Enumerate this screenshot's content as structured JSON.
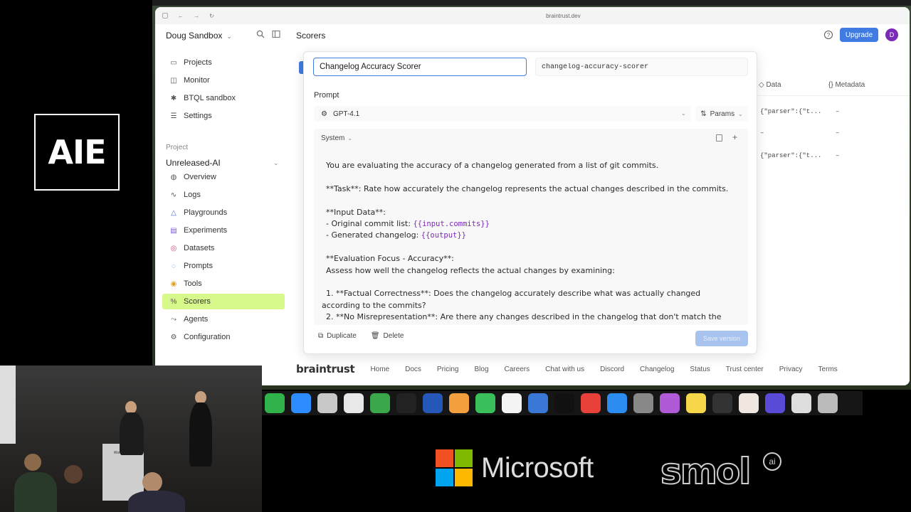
{
  "event_logo": "AIE",
  "browser": {
    "url": "braintrust.dev"
  },
  "header": {
    "workspace": "Doug Sandbox",
    "page_title": "Scorers",
    "upgrade_label": "Upgrade",
    "avatar_initial": "D"
  },
  "sidebar": {
    "top_items": [
      {
        "label": "Projects",
        "icon": "folder-icon"
      },
      {
        "label": "Monitor",
        "icon": "chart-icon"
      },
      {
        "label": "BTQL sandbox",
        "icon": "asterisk-icon"
      },
      {
        "label": "Settings",
        "icon": "sliders-icon"
      }
    ],
    "section_label": "Project",
    "project_name": "Unreleased-AI",
    "project_items": [
      {
        "label": "Overview",
        "icon": "globe-icon"
      },
      {
        "label": "Logs",
        "icon": "activity-icon"
      },
      {
        "label": "Playgrounds",
        "icon": "shapes-icon"
      },
      {
        "label": "Experiments",
        "icon": "beaker-icon"
      },
      {
        "label": "Datasets",
        "icon": "database-icon"
      },
      {
        "label": "Prompts",
        "icon": "message-icon"
      },
      {
        "label": "Tools",
        "icon": "bolt-icon"
      },
      {
        "label": "Scorers",
        "icon": "percent-icon",
        "active": true
      },
      {
        "label": "Agents",
        "icon": "route-icon"
      },
      {
        "label": "Configuration",
        "icon": "gear-icon"
      }
    ]
  },
  "table_bg": {
    "columns": [
      "Data",
      "Metadata"
    ],
    "rows": [
      {
        "data": "{\"parser\":{\"t...",
        "metadata": "–"
      },
      {
        "data": "–",
        "metadata": "–"
      },
      {
        "data": "{\"parser\":{\"t...",
        "metadata": "–"
      }
    ]
  },
  "modal": {
    "name_value": "Changelog Accuracy Scorer",
    "slug_value": "changelog-accuracy-scorer",
    "prompt_label": "Prompt",
    "model": "GPT-4.1",
    "params_label": "Params",
    "role": "System",
    "prompt_lines": {
      "l1": "You are evaluating the accuracy of a changelog generated from a list of git commits.",
      "l2": "**Task**: Rate how accurately the changelog represents the actual changes described in the commits.",
      "l3": "**Input Data**:",
      "l4a": "- Original commit list: ",
      "l4b": "{{input.commits}}",
      "l5a": "- Generated changelog: ",
      "l5b": "{{output}}",
      "l6": "**Evaluation Focus - Accuracy**:",
      "l7": "Assess how well the changelog reflects the actual changes by examining:",
      "l8": "1. **Factual Correctness**: Does the changelog accurately describe what was actually changed",
      "l9": "according to the commits?",
      "l10": "2. **No Misrepresentation**: Are there any changes described in the changelog that don't match the"
    },
    "duplicate_label": "Duplicate",
    "delete_label": "Delete",
    "save_label": "Save version"
  },
  "footer": {
    "brand": "braintrust",
    "links": [
      "Home",
      "Docs",
      "Pricing",
      "Blog",
      "Careers",
      "Chat with us",
      "Discord",
      "Changelog",
      "Status",
      "Trust center",
      "Privacy",
      "Terms"
    ]
  },
  "webcam": {
    "podium_text": "World's Fair"
  },
  "sponsors": {
    "microsoft": "Microsoft",
    "smol": "smol",
    "smol_badge": "ai"
  }
}
